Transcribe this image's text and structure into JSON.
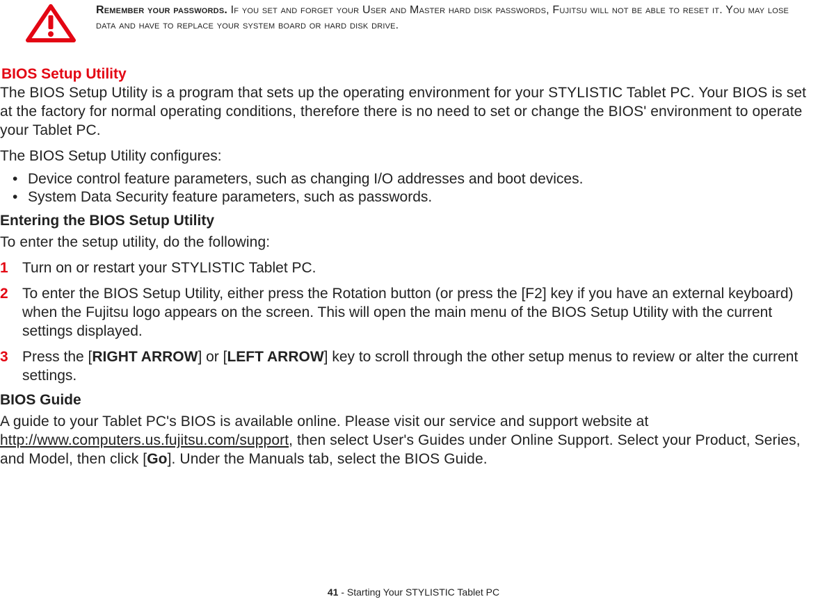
{
  "warning": {
    "lead": "Remember your passwords.",
    "rest": " If you set and forget your User and Master hard disk passwords, Fujitsu will not be able to reset it. You may lose data and have to replace your system board or hard disk drive."
  },
  "section_title": "BIOS Setup Utility",
  "para1": "The BIOS Setup Utility is a program that sets up the operating environment for your STYLISTIC Tablet PC. Your BIOS is set at the factory for normal operating conditions, therefore there is no need to set or change the BIOS' environment to operate your Tablet PC.",
  "para2": "The BIOS Setup Utility configures:",
  "bullets": [
    "Device control feature parameters, such as changing I/O addresses and boot devices.",
    "System Data Security feature parameters, such as passwords."
  ],
  "sub1": "Entering the BIOS Setup Utility",
  "sub1_intro": "To enter the setup utility, do the following:",
  "steps": [
    {
      "n": "1",
      "text": "Turn on or restart your STYLISTIC Tablet PC."
    },
    {
      "n": "2",
      "text": "To enter the BIOS Setup Utility, either press the Rotation button (or press the [F2] key if you have an external keyboard) when the Fujitsu logo appears on the screen. This will open the main menu of the BIOS Setup Utility with the current settings displayed."
    }
  ],
  "step3": {
    "n": "3",
    "pre": "Press the [",
    "ra": "RIGHT ARROW",
    "mid": "] or [",
    "la": "LEFT ARROW",
    "post": "] key to scroll through the other setup menus to review or alter the current settings."
  },
  "sub2": "BIOS Guide",
  "guide": {
    "pre": "A guide to your Tablet PC's BIOS is available online. Please visit our service and support website at ",
    "link_text": "http://www.computers.us.fujitsu.com/support",
    "link_href": "http://www.computers.us.fujitsu.com/support",
    "mid": ", then select User's Guides under Online Support. Select your Product, Series, and Model, then click [",
    "go": "Go",
    "post": "]. Under the Manuals tab, select the BIOS Guide."
  },
  "footer": {
    "page": "41",
    "title": " - Starting Your STYLISTIC Tablet PC"
  }
}
